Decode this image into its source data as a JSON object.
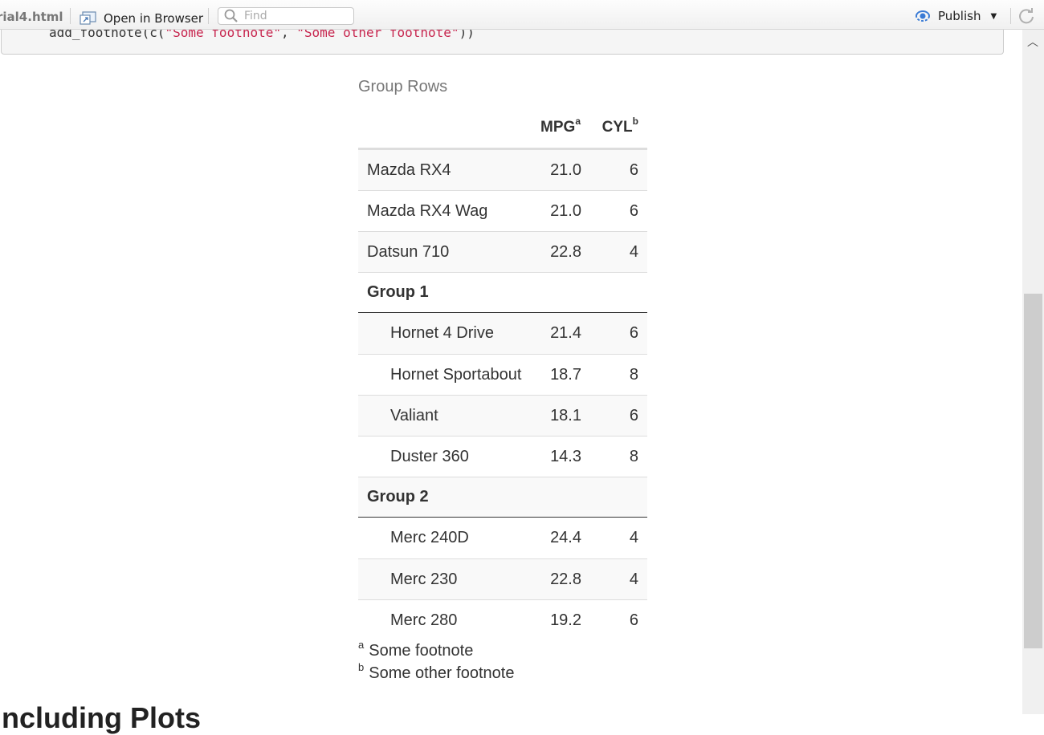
{
  "toolbar": {
    "file_title": "rial4.html",
    "open_in_browser": "Open in Browser",
    "find_placeholder": "Find",
    "publish": "Publish"
  },
  "code": {
    "prefix": "add_footnote(c(",
    "str1": "\"Some footnote\"",
    "comma": ", ",
    "str2": "\"Some other footnote\"",
    "suffix": "))"
  },
  "table": {
    "caption": "Group Rows",
    "headers": {
      "mpg": "MPG",
      "mpg_mark": "a",
      "cyl": "CYL",
      "cyl_mark": "b"
    },
    "rows_top": [
      {
        "name": "Mazda RX4",
        "mpg": "21.0",
        "cyl": "6"
      },
      {
        "name": "Mazda RX4 Wag",
        "mpg": "21.0",
        "cyl": "6"
      },
      {
        "name": "Datsun 710",
        "mpg": "22.8",
        "cyl": "4"
      }
    ],
    "group1": {
      "label": "Group 1",
      "rows": [
        {
          "name": "Hornet 4 Drive",
          "mpg": "21.4",
          "cyl": "6"
        },
        {
          "name": "Hornet Sportabout",
          "mpg": "18.7",
          "cyl": "8"
        },
        {
          "name": "Valiant",
          "mpg": "18.1",
          "cyl": "6"
        },
        {
          "name": "Duster 360",
          "mpg": "14.3",
          "cyl": "8"
        }
      ]
    },
    "group2": {
      "label": "Group 2",
      "rows": [
        {
          "name": "Merc 240D",
          "mpg": "24.4",
          "cyl": "4"
        },
        {
          "name": "Merc 230",
          "mpg": "22.8",
          "cyl": "4"
        },
        {
          "name": "Merc 280",
          "mpg": "19.2",
          "cyl": "6"
        }
      ]
    }
  },
  "footnotes": [
    {
      "mark": "a",
      "text": "Some footnote"
    },
    {
      "mark": "b",
      "text": "Some other footnote"
    }
  ],
  "next_heading": "Including Plots"
}
